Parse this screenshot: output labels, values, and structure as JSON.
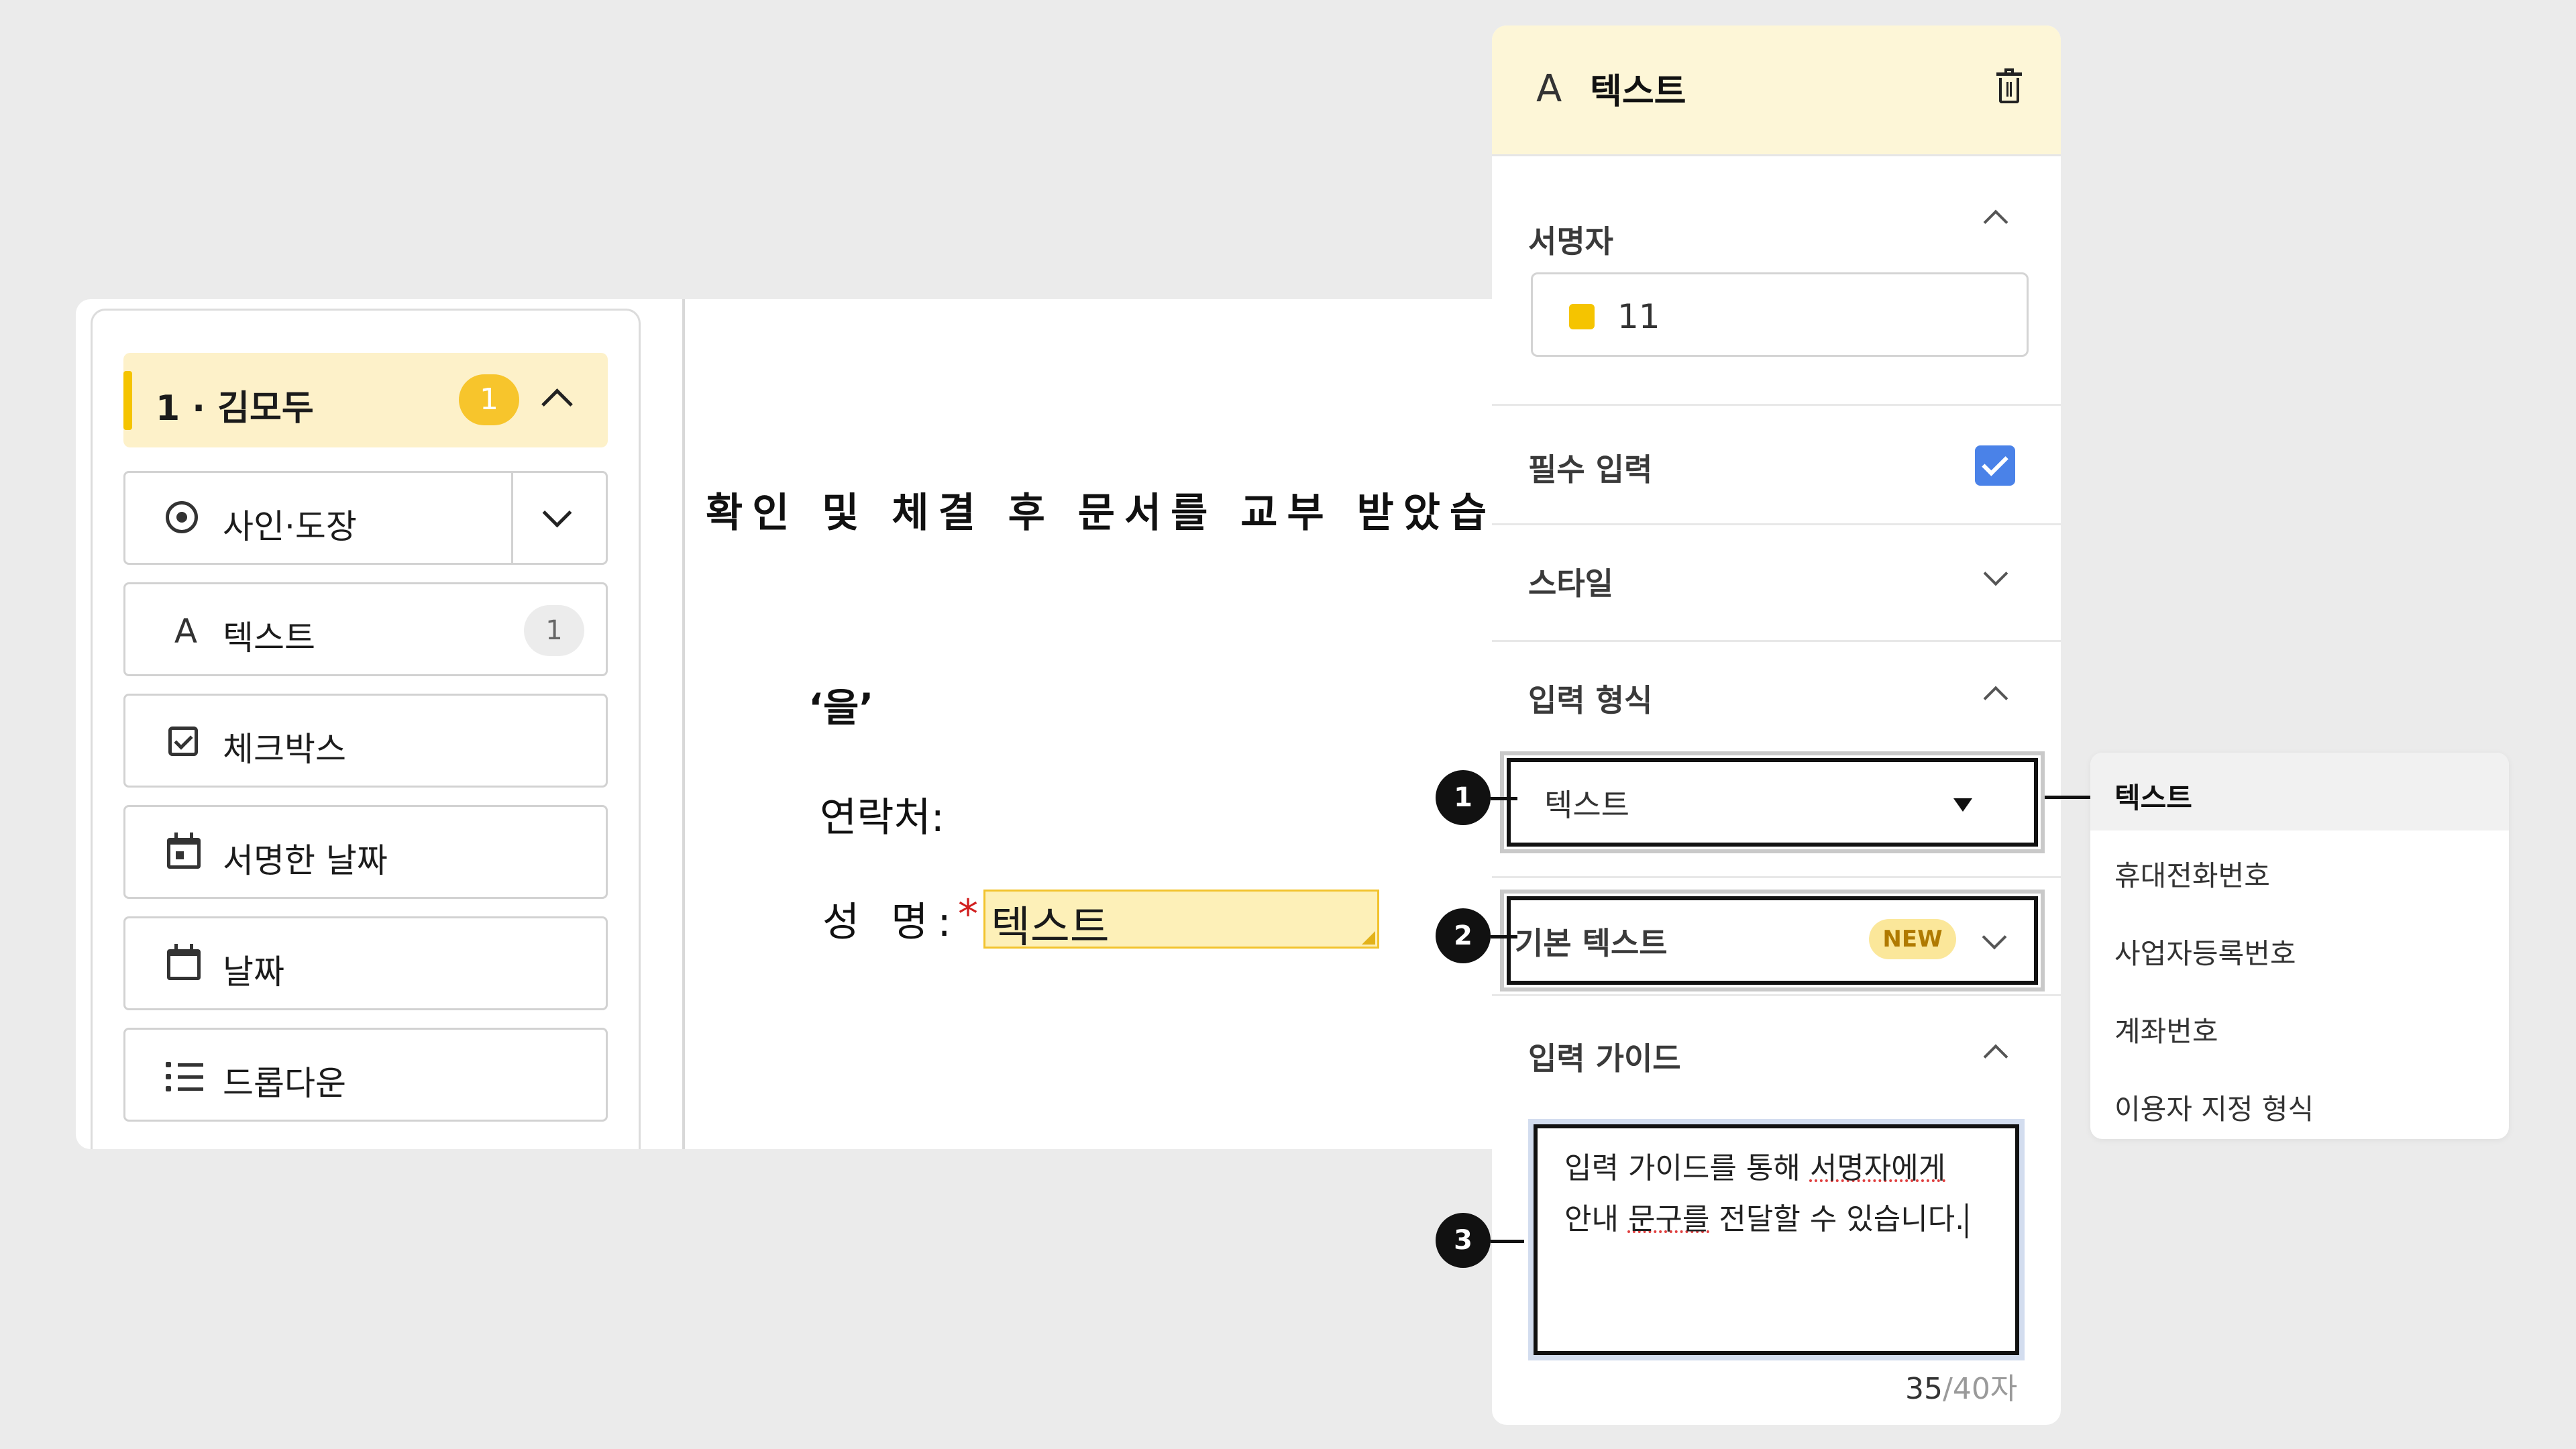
{
  "left_panel": {
    "signer": {
      "label": "1 · 김모두",
      "count": "1"
    },
    "tools": [
      {
        "label": "사인·도장",
        "icon": "stamp-radio-icon",
        "badge": ""
      },
      {
        "label": "텍스트",
        "icon": "text-a-icon",
        "badge": "1"
      },
      {
        "label": "체크박스",
        "icon": "checkbox-icon",
        "badge": ""
      },
      {
        "label": "서명한 날짜",
        "icon": "signed-date-calendar-icon",
        "badge": ""
      },
      {
        "label": "날짜",
        "icon": "calendar-icon",
        "badge": ""
      },
      {
        "label": "드롭다운",
        "icon": "list-icon",
        "badge": ""
      }
    ]
  },
  "document": {
    "heading": "확인 및 체결 후 문서를 교부 받았습니",
    "eul": "‘을’",
    "contact_label": "연락처:",
    "name_label": "성 명:",
    "required_mark": "*",
    "field_text": "텍스트"
  },
  "property_panel": {
    "title": "텍스트",
    "sections": {
      "signer": {
        "label": "서명자",
        "value": "11"
      },
      "required": {
        "label": "필수 입력",
        "checked": true
      },
      "style": {
        "label": "스타일"
      },
      "input_format": {
        "label": "입력 형식",
        "value": "텍스트"
      },
      "default_text": {
        "label": "기본 텍스트",
        "badge": "NEW"
      },
      "input_guide": {
        "label": "입력 가이드",
        "line1_a": "입력 가이드를 통해 ",
        "line1_b": "서명자에게",
        "line2_a": "안내 ",
        "line2_b": "문구를",
        "line2_c": " 전달할 수 있습니다.",
        "count": "35",
        "max": "/40자"
      }
    }
  },
  "markers": [
    "1",
    "2",
    "3"
  ],
  "format_options": [
    "텍스트",
    "휴대전화번호",
    "사업자등록번호",
    "계좌번호",
    "이용자 지정 형식"
  ],
  "colors": {
    "accent_yellow": "#f5c400",
    "check_blue": "#4a82e8",
    "required_red": "#d11f1f"
  }
}
